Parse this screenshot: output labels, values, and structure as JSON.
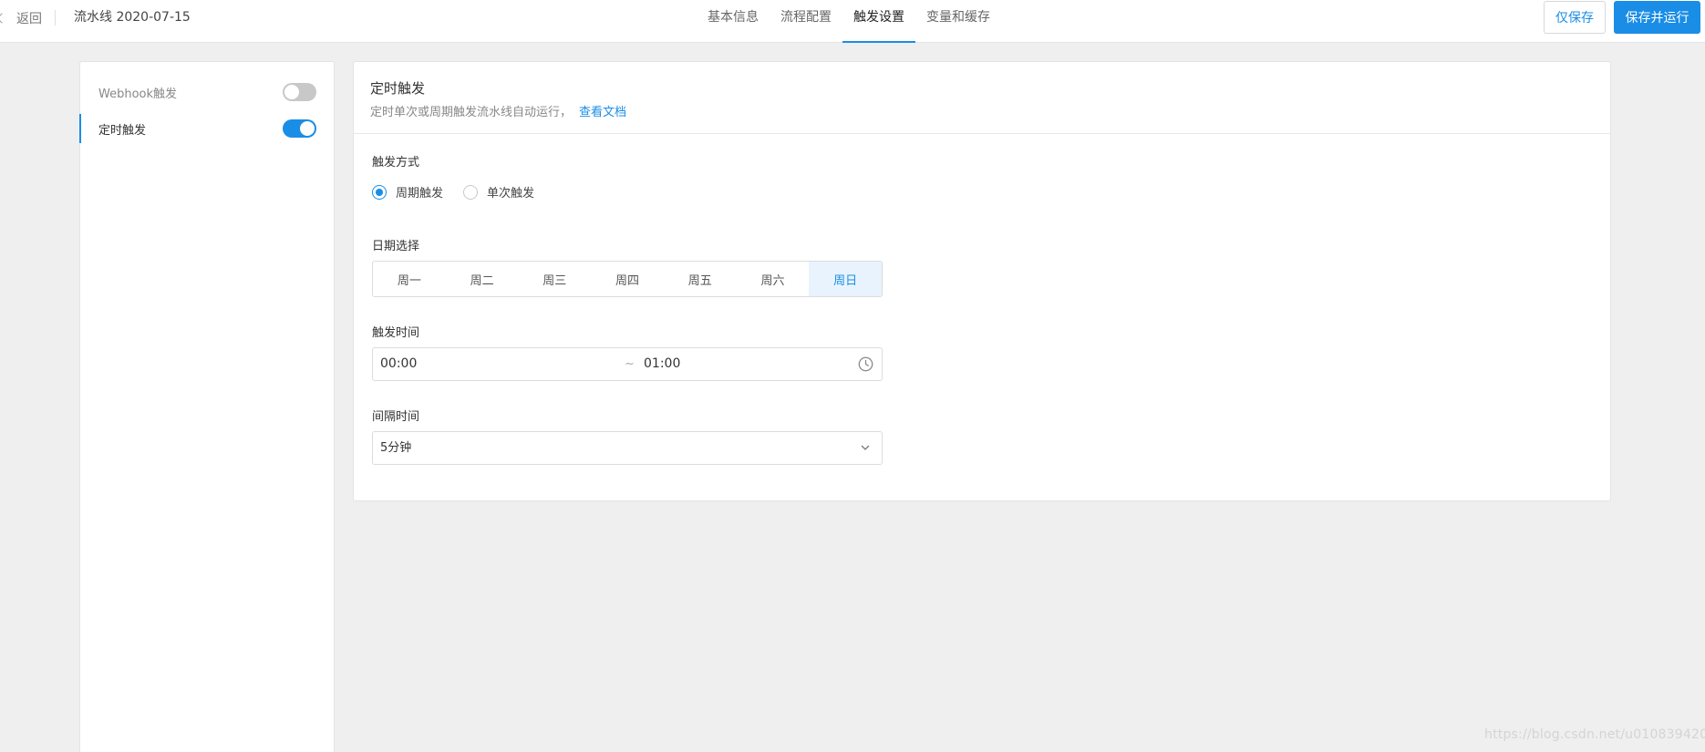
{
  "topbar": {
    "back_label": "返回",
    "pipeline_title": "流水线 2020-07-15",
    "tabs": [
      {
        "label": "基本信息",
        "active": false
      },
      {
        "label": "流程配置",
        "active": false
      },
      {
        "label": "触发设置",
        "active": true
      },
      {
        "label": "变量和缓存",
        "active": false
      }
    ],
    "save_only_label": "仅保存",
    "save_and_run_label": "保存并运行"
  },
  "sidebar": {
    "items": [
      {
        "label": "Webhook触发",
        "enabled": false,
        "active": false
      },
      {
        "label": "定时触发",
        "enabled": true,
        "active": true
      }
    ]
  },
  "main": {
    "title": "定时触发",
    "description": "定时单次或周期触发流水线自动运行，",
    "doc_link": "查看文档",
    "trigger_mode": {
      "label": "触发方式",
      "options": [
        {
          "label": "周期触发",
          "checked": true
        },
        {
          "label": "单次触发",
          "checked": false
        }
      ]
    },
    "date_select": {
      "label": "日期选择",
      "days": [
        {
          "label": "周一",
          "selected": false
        },
        {
          "label": "周二",
          "selected": false
        },
        {
          "label": "周三",
          "selected": false
        },
        {
          "label": "周四",
          "selected": false
        },
        {
          "label": "周五",
          "selected": false
        },
        {
          "label": "周六",
          "selected": false
        },
        {
          "label": "周日",
          "selected": true
        }
      ]
    },
    "trigger_time": {
      "label": "触发时间",
      "start": "00:00",
      "separator": "~",
      "end": "01:00"
    },
    "interval": {
      "label": "间隔时间",
      "value": "5分钟"
    }
  },
  "watermark": "https://blog.csdn.net/u010839420",
  "colors": {
    "accent": "#1a8de6",
    "background": "#efefef",
    "toggle_off": "#c8c8c8"
  }
}
